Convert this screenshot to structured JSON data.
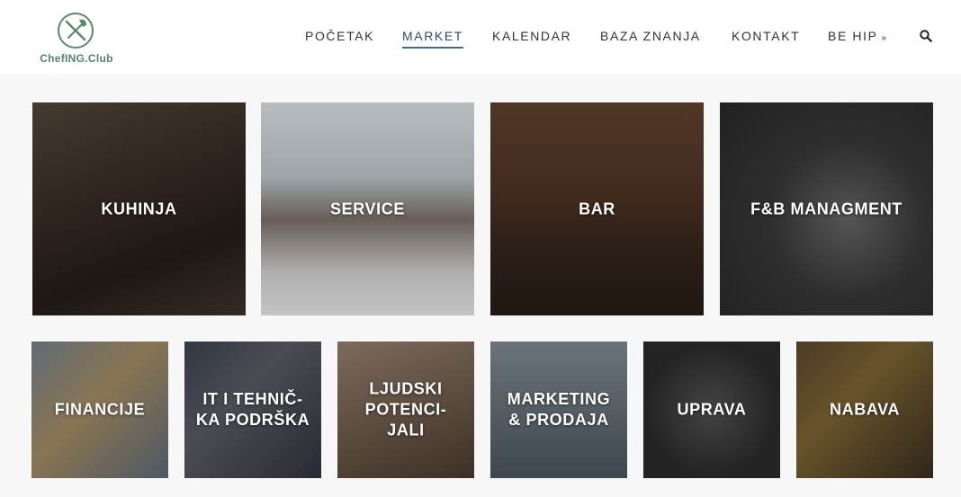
{
  "logo": {
    "text": "ChefING.Club"
  },
  "nav": {
    "items": [
      {
        "label": "POČETAK"
      },
      {
        "label": "MARKET"
      },
      {
        "label": "KALENDAR"
      },
      {
        "label": "BAZA ZNANJA"
      },
      {
        "label": "KONTAKT"
      },
      {
        "label": "BE HIP"
      }
    ],
    "active": "MARKET"
  },
  "tiles_top": [
    {
      "label": "KUHINJA"
    },
    {
      "label": "SERVICE"
    },
    {
      "label": "BAR"
    },
    {
      "label": "F&B MANAGMENT"
    }
  ],
  "tiles_bottom": [
    {
      "label": "FINANCIJE"
    },
    {
      "label": "IT I TEHNIČ-KA PODRŠKA"
    },
    {
      "label": "LJUDSKI POTENCI-JALI"
    },
    {
      "label": "MARKETING & PRODAJA"
    },
    {
      "label": "UPRAVA"
    },
    {
      "label": "NABAVA"
    }
  ]
}
